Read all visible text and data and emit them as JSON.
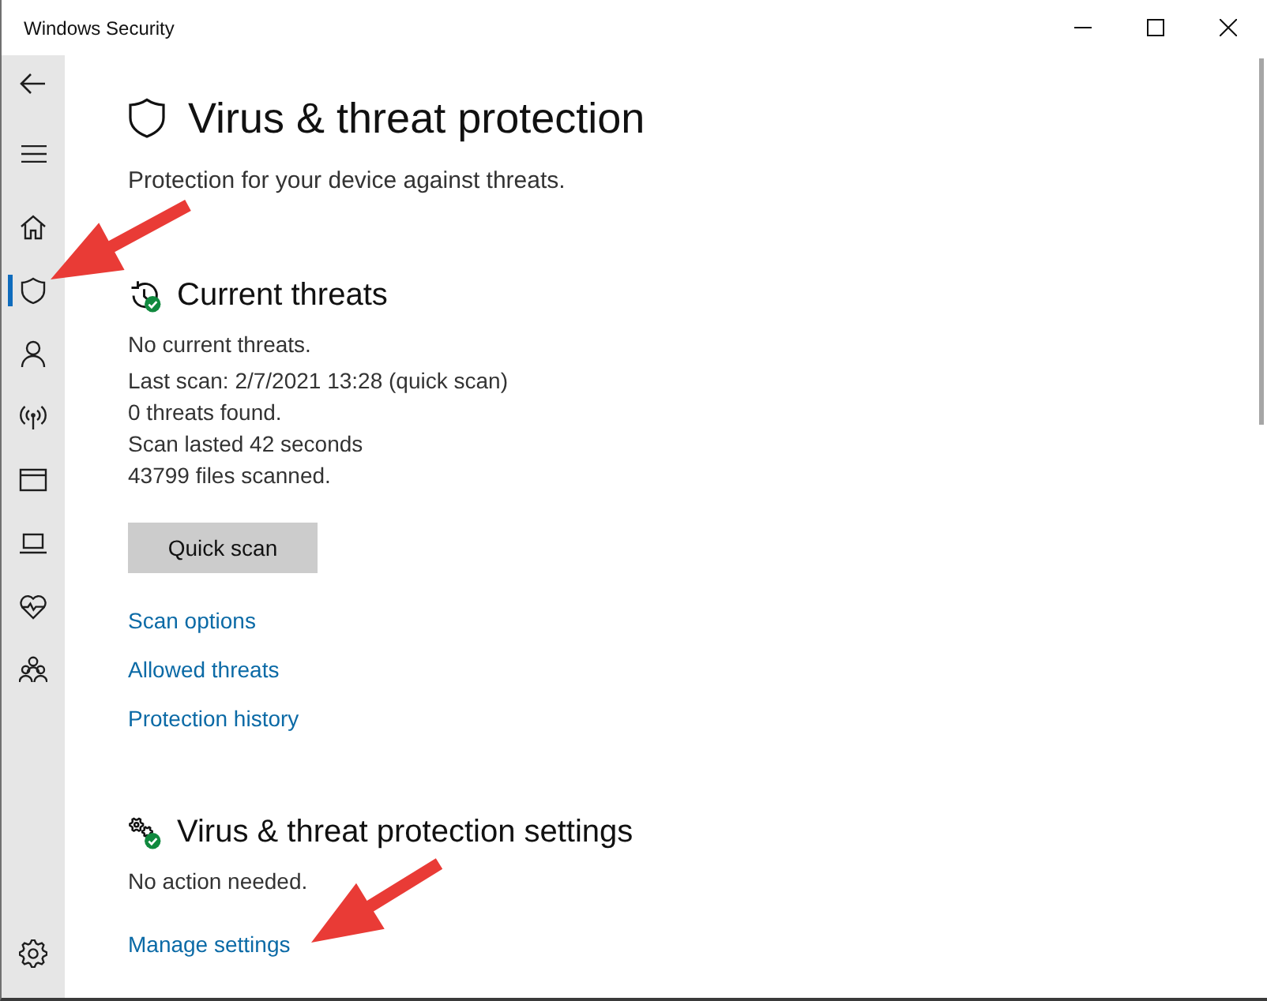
{
  "window": {
    "title": "Windows Security"
  },
  "sidebar": {
    "items": [
      {
        "kind": "home",
        "selected": false
      },
      {
        "kind": "shield",
        "selected": true
      },
      {
        "kind": "person",
        "selected": false
      },
      {
        "kind": "antenna",
        "selected": false
      },
      {
        "kind": "window",
        "selected": false
      },
      {
        "kind": "laptop",
        "selected": false
      },
      {
        "kind": "heart",
        "selected": false
      },
      {
        "kind": "people",
        "selected": false
      }
    ],
    "footer_items": [
      {
        "kind": "gear",
        "selected": false
      }
    ]
  },
  "page": {
    "title": "Virus & threat protection",
    "subtitle": "Protection for your device against threats."
  },
  "sections": [
    {
      "kind": "threats",
      "ok": true,
      "title": "Current threats",
      "summary": "No current threats.",
      "details": [
        "Last scan: 2/7/2021 13:28 (quick scan)",
        "0 threats found.",
        "Scan lasted 42 seconds",
        "43799 files scanned."
      ],
      "button": "Quick scan",
      "links": [
        "Scan options",
        "Allowed threats",
        "Protection history"
      ]
    },
    {
      "kind": "settings",
      "ok": true,
      "title": "Virus & threat protection settings",
      "summary": "No action needed.",
      "links": [
        "Manage settings"
      ]
    }
  ],
  "annotations": [
    {
      "kind": "arrow"
    },
    {
      "kind": "arrow"
    }
  ]
}
